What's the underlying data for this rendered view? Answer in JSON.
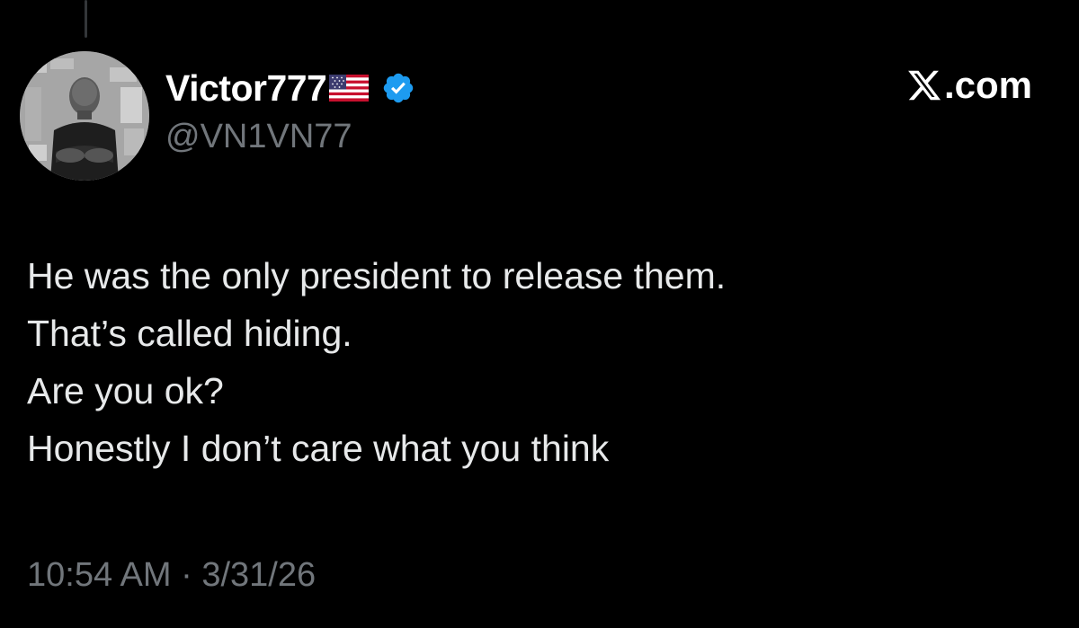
{
  "author": {
    "display_name": "Victor777",
    "flag_icon": "us-flag-icon",
    "verified_icon": "verified-badge-icon",
    "verified_color": "#1d9bf0",
    "handle": "@VN1VN77"
  },
  "brand": {
    "logo_icon": "x-logo-icon",
    "suffix": ".com"
  },
  "tweet": {
    "lines": [
      "He was the only president to release them.",
      "That’s called hiding.",
      "Are you ok?",
      "Honestly I don’t care what you think"
    ],
    "timestamp": "10:54 AM · 3/31/26"
  },
  "colors": {
    "background": "#000000",
    "text_primary": "#e7e9ea",
    "text_secondary": "#71767b"
  }
}
